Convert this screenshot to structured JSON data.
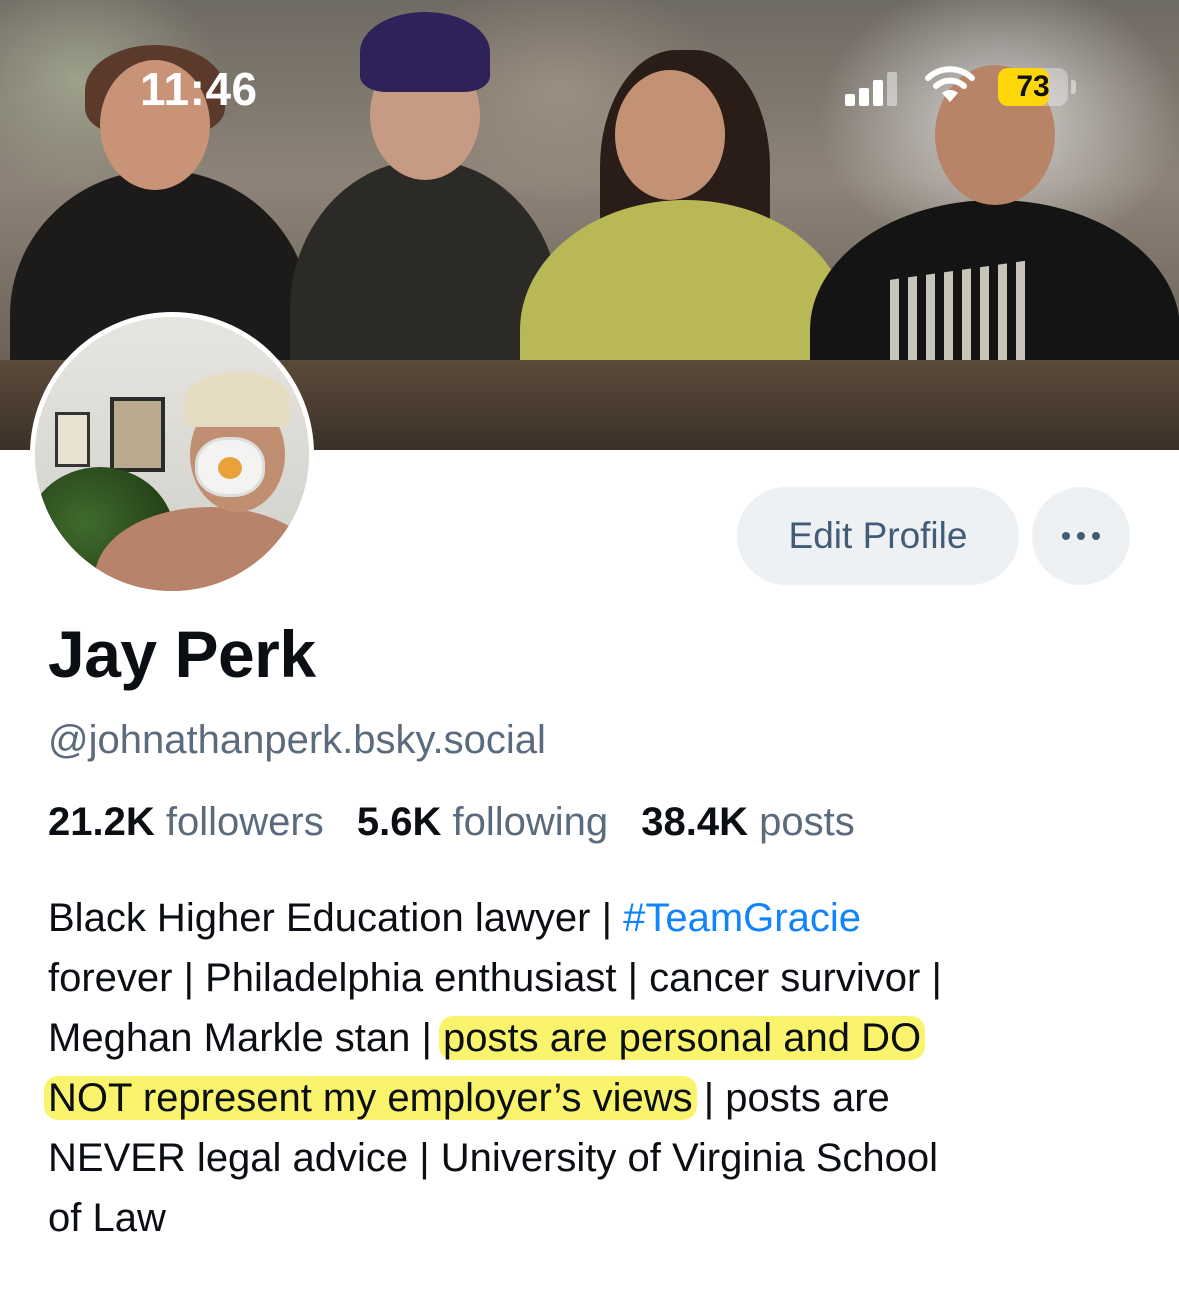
{
  "status_bar": {
    "time": "11:46",
    "battery_percent": "73",
    "battery_level": 0.73,
    "signal_icon": "cellular-signal-icon",
    "wifi_icon": "wifi-icon",
    "battery_icon": "battery-icon",
    "battery_color": "#ffd60a"
  },
  "profile": {
    "display_name": "Jay Perk",
    "handle": "@johnathanperk.bsky.social",
    "edit_button_label": "Edit Profile",
    "more_icon": "ellipsis-icon",
    "stats": {
      "followers_count": "21.2K",
      "followers_label": "followers",
      "following_count": "5.6K",
      "following_label": "following",
      "posts_count": "38.4K",
      "posts_label": "posts"
    },
    "bio": {
      "l1a": "Black Higher Education lawyer | ",
      "l1_tag": "#TeamGracie",
      "l2": "forever | Philadelphia enthusiast | cancer survivor |",
      "l3a": "Meghan Markle stan | ",
      "l3_hl": "posts are personal and DO",
      "l4_hl": "NOT represent my employer’s views",
      "l4b": " | posts are",
      "l5": "NEVER legal advice | University of Virginia School",
      "l6": "of Law"
    }
  },
  "colors": {
    "link": "#1083fe",
    "muted_text": "#5a6b7e",
    "button_bg": "#eef1f4",
    "button_text": "#425c78",
    "highlight": "#f8f03c"
  }
}
